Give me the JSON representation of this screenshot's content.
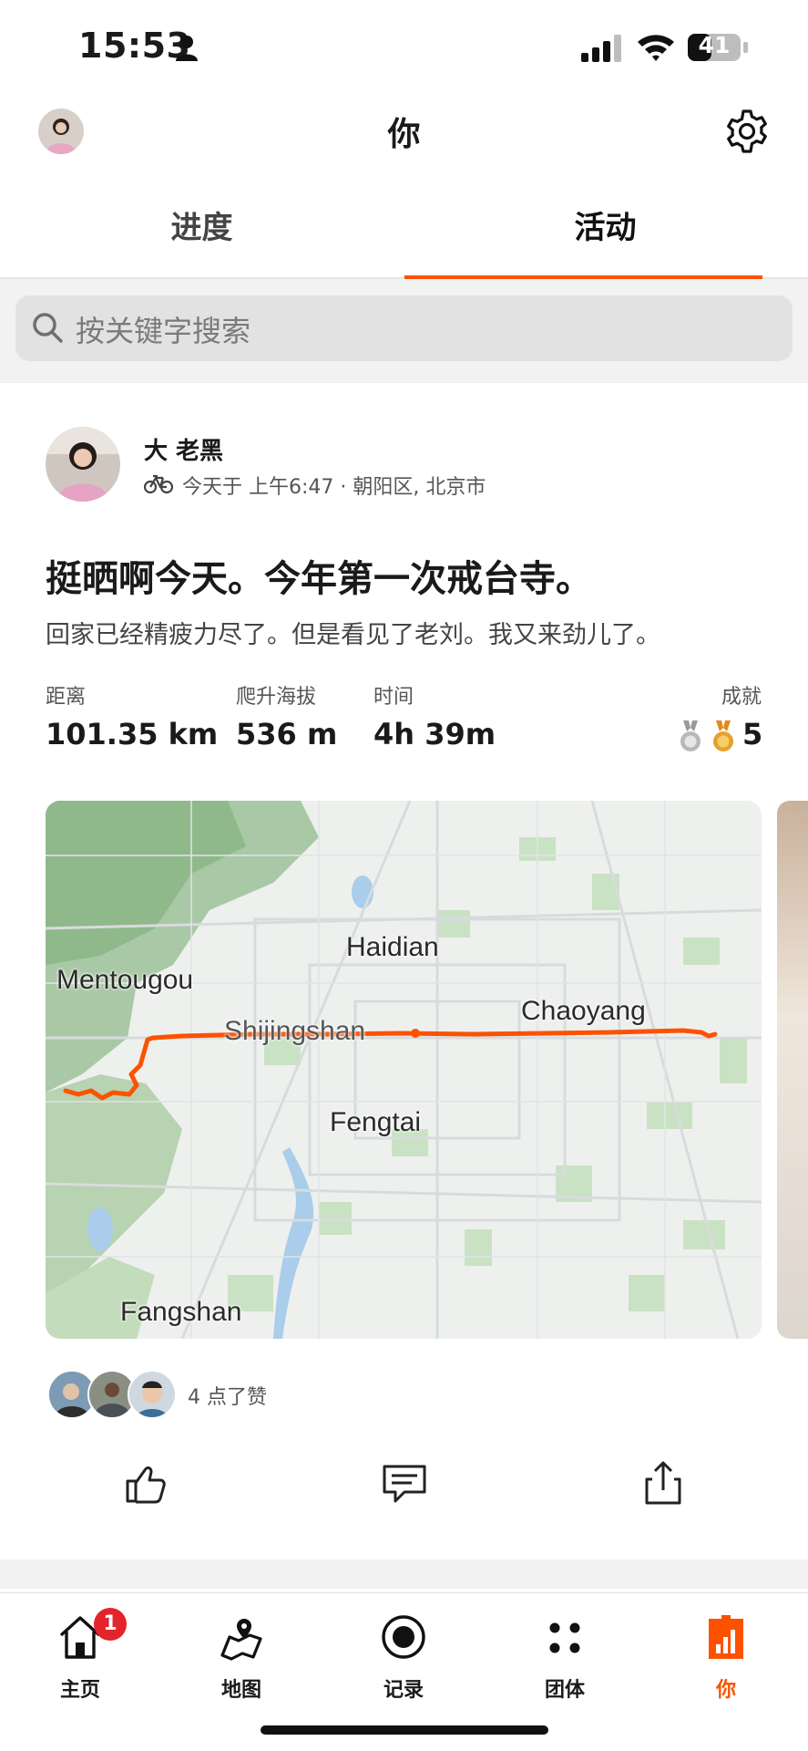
{
  "status_bar": {
    "time": "15:53",
    "battery": "41"
  },
  "header": {
    "title": "你"
  },
  "tabs": [
    {
      "label": "进度",
      "active": false
    },
    {
      "label": "活动",
      "active": true
    }
  ],
  "search": {
    "placeholder": "按关键字搜索"
  },
  "activity": {
    "author_name": "大 老黑",
    "meta": "今天于 上午6:47 · 朝阳区, 北京市",
    "title": "挺晒啊今天。今年第一次戒台寺。",
    "description": "回家已经精疲力尽了。但是看见了老刘。我又来劲儿了。",
    "stats": [
      {
        "label": "距离",
        "value": "101.35 km"
      },
      {
        "label": "爬升海拔",
        "value": "536 m"
      },
      {
        "label": "时间",
        "value": "4h 39m"
      }
    ],
    "achievements_label": "成就",
    "achievements_count": "5",
    "map_labels": {
      "haidian": "Haidian",
      "mentougou": "Mentougou",
      "chaoyang": "Chaoyang",
      "shijingshan": "Shijingshan",
      "fengtai": "Fengtai",
      "fangshan": "Fangshan"
    },
    "kudos_text": "4 点了赞"
  },
  "bottom_nav": {
    "items": [
      {
        "label": "主页",
        "icon": "home-icon",
        "badge": "1"
      },
      {
        "label": "地图",
        "icon": "map-icon"
      },
      {
        "label": "记录",
        "icon": "record-icon"
      },
      {
        "label": "团体",
        "icon": "groups-icon"
      },
      {
        "label": "你",
        "icon": "you-icon",
        "active": true
      }
    ]
  },
  "colors": {
    "accent": "#fc5200",
    "badge": "#e3242b"
  }
}
